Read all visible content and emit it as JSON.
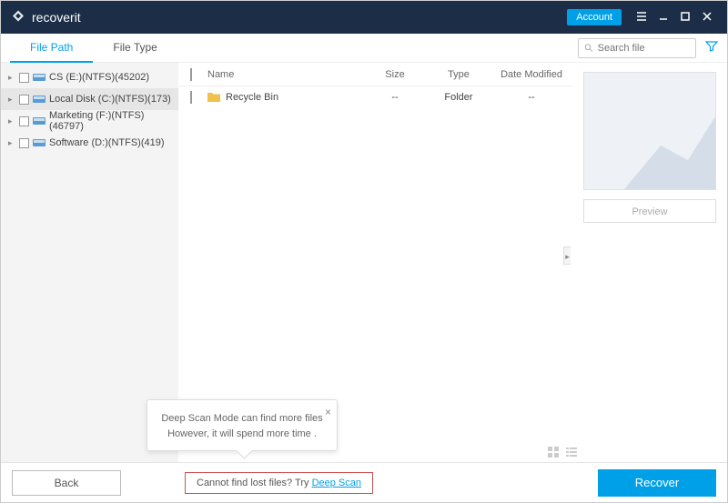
{
  "header": {
    "logo_brand_main": "recover",
    "logo_brand_suffix": "it",
    "account_btn": "Account"
  },
  "tabs": {
    "file_path": "File Path",
    "file_type": "File Type"
  },
  "search": {
    "placeholder": "Search file"
  },
  "sidebar": {
    "items": [
      {
        "label": "CS (E:)(NTFS)(45202)"
      },
      {
        "label": "Local Disk (C:)(NTFS)(173)"
      },
      {
        "label": "Marketing (F:)(NTFS)(46797)"
      },
      {
        "label": "Software (D:)(NTFS)(419)"
      }
    ]
  },
  "columns": {
    "name": "Name",
    "size": "Size",
    "type": "Type",
    "date": "Date Modified"
  },
  "rows": [
    {
      "name": "Recycle Bin",
      "size": "--",
      "type": "Folder",
      "date": "--"
    }
  ],
  "preview": {
    "btn": "Preview"
  },
  "footer": {
    "back": "Back",
    "deep_scan_text": "Cannot find lost files? Try ",
    "deep_scan_link": "Deep Scan",
    "recover": "Recover"
  },
  "tooltip": {
    "line1": "Deep Scan Mode can find more files",
    "line2": "However, it will spend more time ."
  },
  "colors": {
    "accent": "#00a0e9",
    "header_bg": "#1c2e47"
  }
}
